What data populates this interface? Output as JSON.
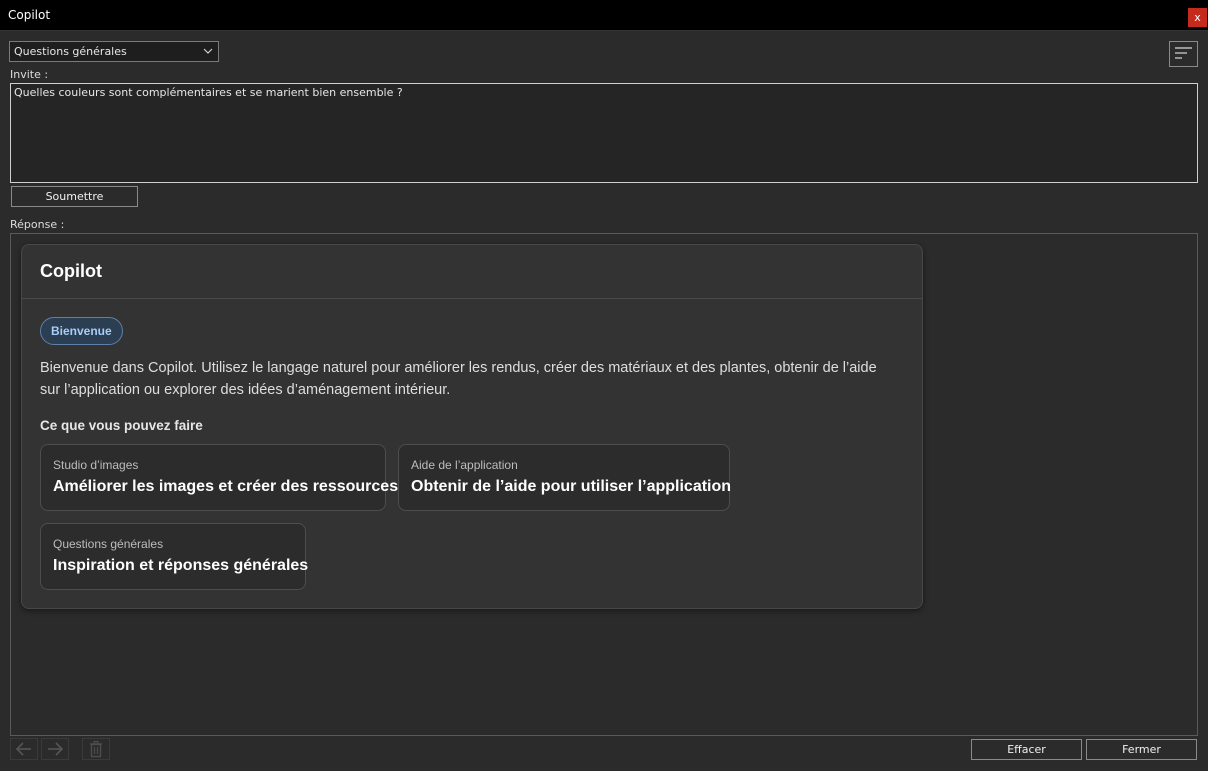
{
  "window": {
    "title": "Copilot",
    "close_label": "x"
  },
  "mode_select": {
    "selected": "Questions générales"
  },
  "prompt": {
    "label": "Invite :",
    "value": "Quelles couleurs sont complémentaires et se marient bien ensemble ?"
  },
  "submit_label": "Soumettre",
  "response": {
    "label": "Réponse :",
    "card": {
      "title": "Copilot",
      "badge": "Bienvenue",
      "intro": "Bienvenue dans Copilot. Utilisez le langage naturel pour améliorer les rendus, créer des matériaux et des plantes, obtenir de l’aide sur l’application ou explorer des idées d’aménagement intérieur.",
      "subheading": "Ce que vous pouvez faire",
      "tiles": [
        {
          "caption": "Studio d’images",
          "heading": "Améliorer les images et créer des ressources"
        },
        {
          "caption": "Aide de l’application",
          "heading": "Obtenir de l’aide pour utiliser l’application"
        },
        {
          "caption": "Questions générales",
          "heading": "Inspiration et réponses générales"
        }
      ]
    }
  },
  "footer": {
    "back_icon": "arrow-left-icon",
    "forward_icon": "arrow-right-icon",
    "delete_icon": "trash-icon",
    "clear_label": "Effacer",
    "close_label": "Fermer"
  },
  "colors": {
    "background": "#2b2b2b",
    "titlebar": "#000000",
    "close_button": "#c42b1c",
    "card": "#333333",
    "badge_text": "#a8cdf5"
  }
}
